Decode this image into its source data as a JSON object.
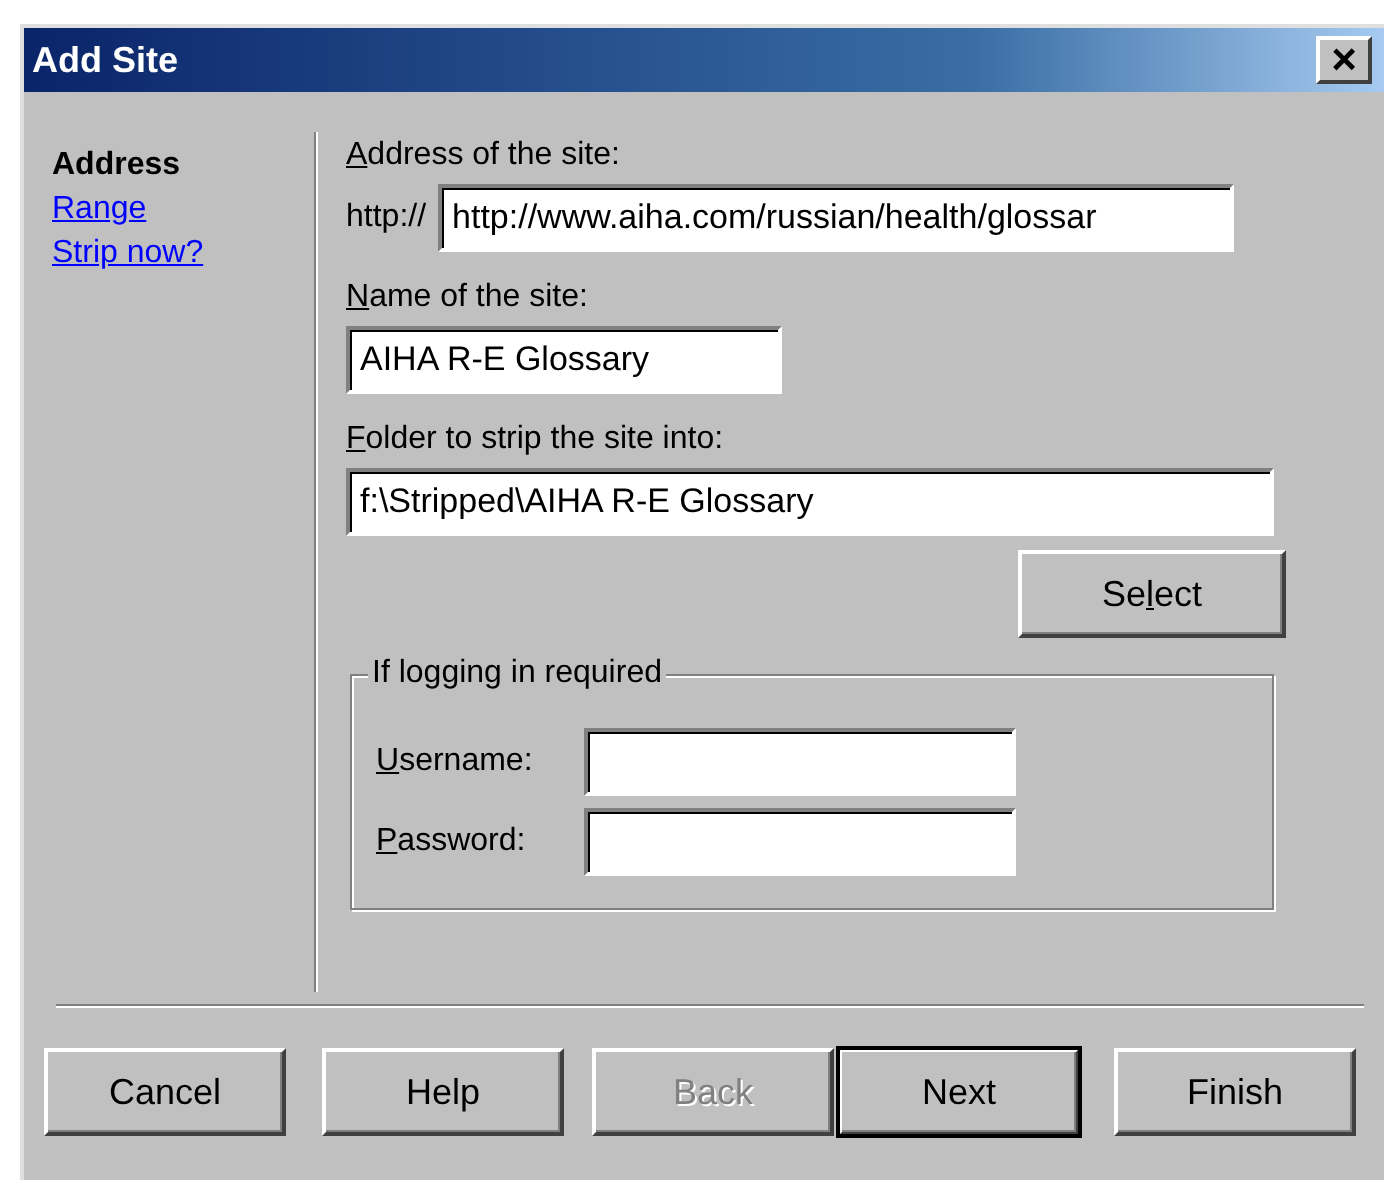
{
  "window": {
    "title": "Add Site",
    "close": "×"
  },
  "sidebar": {
    "items": [
      {
        "label": "Address",
        "selected": true
      },
      {
        "label": "Range",
        "selected": false
      },
      {
        "label": "Strip now?",
        "selected": false
      }
    ]
  },
  "address": {
    "label": {
      "key": "A",
      "after": "ddress of the site:"
    },
    "prefix": "http://",
    "value": "http://www.aiha.com/russian/health/glossar"
  },
  "name": {
    "label": {
      "key": "N",
      "after": "ame of the site:"
    },
    "value": "AIHA R-E Glossary"
  },
  "folder": {
    "label": {
      "key": "F",
      "after": "older to strip the site into:"
    },
    "value": "f:\\Stripped\\AIHA R-E Glossary"
  },
  "select_button": {
    "label": {
      "before": "Se",
      "key": "l",
      "after": "ect"
    }
  },
  "login": {
    "title": "If logging in required",
    "fields": [
      {
        "label": {
          "key": "U",
          "after": "sername:"
        }
      },
      {
        "label": {
          "key": "P",
          "after": "assword:"
        }
      }
    ]
  },
  "buttons": [
    {
      "label": "Cancel",
      "disabled": false,
      "default": false
    },
    {
      "label": "Help",
      "disabled": false,
      "default": false
    },
    {
      "label": "Back",
      "disabled": true,
      "default": false
    },
    {
      "label": "Next",
      "disabled": false,
      "default": true
    },
    {
      "label": "Finish",
      "disabled": false,
      "default": false
    }
  ]
}
